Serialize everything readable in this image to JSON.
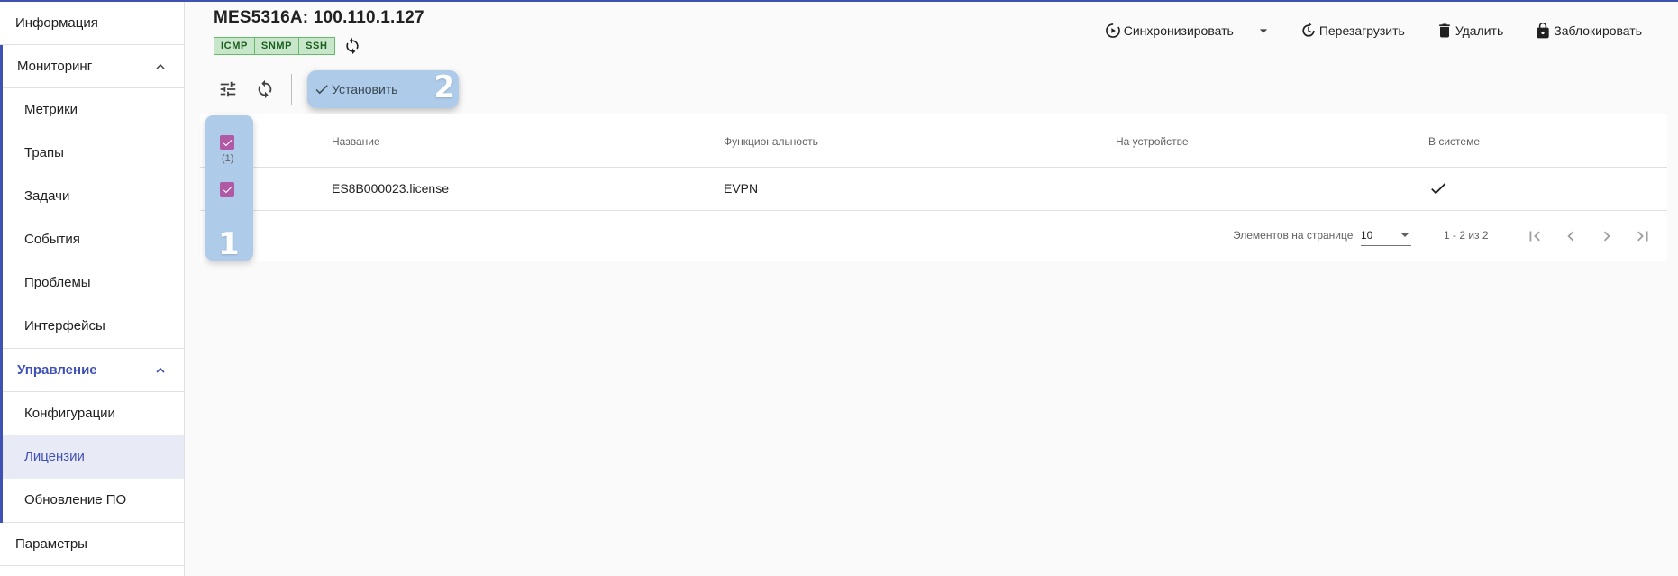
{
  "sidebar": {
    "info": "Информация",
    "monitoring": {
      "label": "Мониторинг",
      "items": [
        "Метрики",
        "Трапы",
        "Задачи",
        "События",
        "Проблемы",
        "Интерфейсы"
      ]
    },
    "management": {
      "label": "Управление",
      "items": [
        "Конфигурации",
        "Лицензии",
        "Обновление ПО"
      ],
      "selected": "Лицензии"
    },
    "params": "Параметры"
  },
  "header": {
    "title": "MES5316A: 100.110.1.127",
    "badges": [
      "ICMP",
      "SNMP",
      "SSH"
    ],
    "actions": {
      "sync": "Синхронизировать",
      "reboot": "Перезагрузить",
      "delete": "Удалить",
      "lock": "Заблокировать"
    }
  },
  "toolbar": {
    "install": "Установить"
  },
  "table": {
    "columns": [
      "Название",
      "Функциональность",
      "На устройстве",
      "В системе"
    ],
    "selected_count": "(1)",
    "rows": [
      {
        "name": "ES8B000023.license",
        "functionality": "EVPN",
        "on_device": "",
        "in_system": true
      }
    ]
  },
  "paginator": {
    "label": "Элементов на странице",
    "page_size": "10",
    "range": "1 - 2 из 2"
  },
  "highlights": {
    "one": "1",
    "two": "2"
  },
  "colors": {
    "accent": "#3f51b5",
    "checkbox": "#b05aa6",
    "highlight": "#aecbea",
    "badge_bg": "#c8e6c9"
  }
}
